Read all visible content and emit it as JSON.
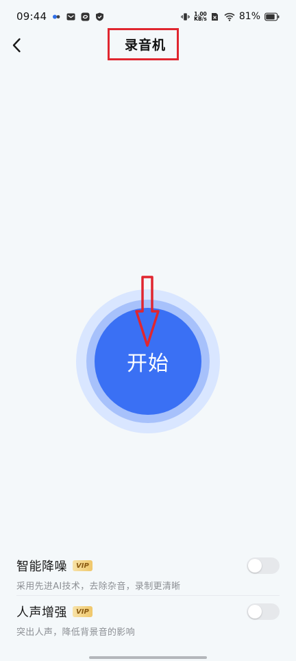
{
  "status_bar": {
    "time": "09:44",
    "net_speed_value": "1.00",
    "net_speed_unit": "KB/s",
    "battery_percent": "81%"
  },
  "header": {
    "title": "录音机",
    "back_icon": "chevron-left-icon"
  },
  "recorder": {
    "start_label": "开始"
  },
  "settings": [
    {
      "name": "智能降噪",
      "badge": "VIP",
      "description": "采用先进AI技术，去除杂音，录制更清晰",
      "enabled": false
    },
    {
      "name": "人声增强",
      "badge": "VIP",
      "description": "突出人声，降低背景音的影响",
      "enabled": false
    }
  ],
  "colors": {
    "primary": "#3a70f4",
    "ring_inner": "#a7c1fb",
    "ring_outer": "#d9e6ff",
    "annotation": "#e0262f",
    "background": "#f4f8fa"
  }
}
